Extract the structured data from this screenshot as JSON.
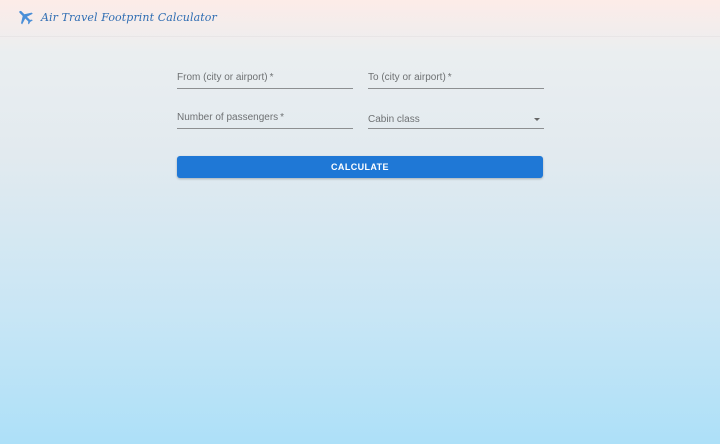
{
  "header": {
    "title": "Air Travel Footprint Calculator",
    "logo_icon": "airplane-icon"
  },
  "form": {
    "from_label": "From (city or airport)",
    "to_label": "To (city or airport)",
    "passengers_label": "Number of passengers",
    "cabin_label": "Cabin class",
    "required_marker": "*",
    "cabin_dropdown_icon": "chevron-down-icon",
    "submit_label": "CALCULATE"
  },
  "colors": {
    "accent": "#1f78d6",
    "title": "#2f6db3",
    "background_top": "#fdece8",
    "background_bottom": "#ade0f8"
  }
}
